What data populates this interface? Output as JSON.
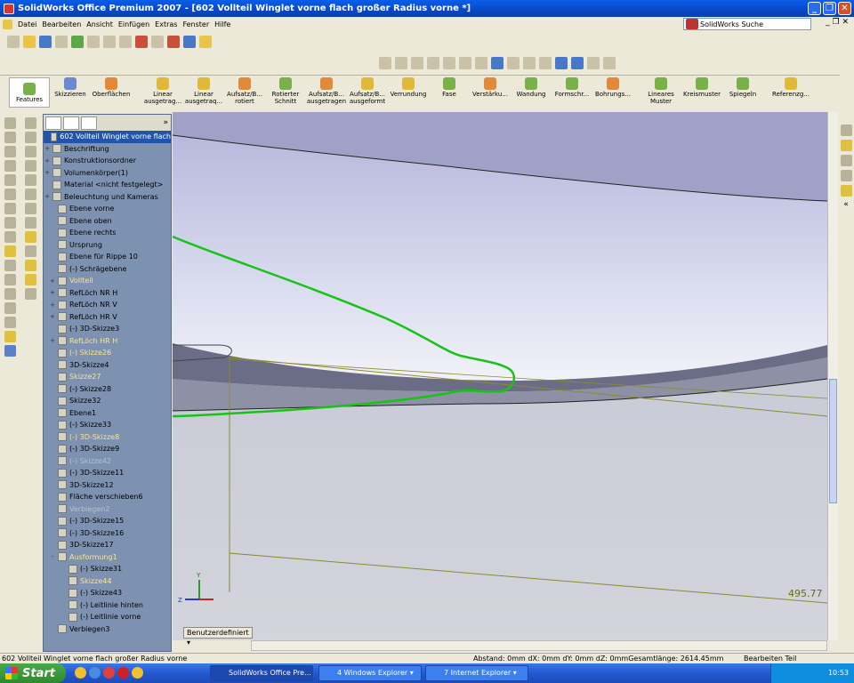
{
  "window": {
    "title": "SolidWorks Office Premium 2007 - [602 Vollteil Winglet vorne flach großer Radius vorne *]"
  },
  "menu": [
    "Datei",
    "Bearbeiten",
    "Ansicht",
    "Einfügen",
    "Extras",
    "Fenster",
    "Hilfe"
  ],
  "search": {
    "placeholder": "SolidWorks Suche"
  },
  "ribbon": {
    "tabs": [
      "Features",
      "Skizzieren",
      "Oberflächen"
    ],
    "tools": [
      "Linear ausgetrag...",
      "Linear ausgetraq...",
      "Aufsatz/B... rotiert",
      "Rotierter Schnitt",
      "Aufsatz/B... ausgetragen",
      "Aufsatz/B... ausgeformt",
      "Verrundung",
      "Fase",
      "Verstärku...",
      "Wandung",
      "Formschr...",
      "Bohrungs...",
      "Lineares Muster",
      "Kreismuster",
      "Spiegeln",
      "Referenzg..."
    ]
  },
  "tree": [
    {
      "label": "602 Vollteil Winglet vorne flach",
      "state": "sel",
      "exp": ""
    },
    {
      "label": "Beschriftung",
      "state": "",
      "exp": "+"
    },
    {
      "label": "Konstruktionsordner",
      "state": "",
      "exp": "+"
    },
    {
      "label": "Volumenkörper(1)",
      "state": "",
      "exp": "+"
    },
    {
      "label": "Material <nicht festgelegt>",
      "state": "",
      "exp": ""
    },
    {
      "label": "Beleuchtung und Kameras",
      "state": "",
      "exp": "+"
    },
    {
      "label": "Ebene vorne",
      "state": "",
      "exp": ""
    },
    {
      "label": "Ebene oben",
      "state": "",
      "exp": ""
    },
    {
      "label": "Ebene rechts",
      "state": "",
      "exp": ""
    },
    {
      "label": "Ursprung",
      "state": "",
      "exp": ""
    },
    {
      "label": "Ebene für Rippe 10",
      "state": "",
      "exp": ""
    },
    {
      "label": "(-) Schrägebene",
      "state": "",
      "exp": ""
    },
    {
      "label": "Vollteil",
      "state": "warn",
      "exp": "+"
    },
    {
      "label": "RefLöch NR H",
      "state": "",
      "exp": "+"
    },
    {
      "label": "RefLöch NR V",
      "state": "",
      "exp": "+"
    },
    {
      "label": "RefLöch HR V",
      "state": "",
      "exp": "+"
    },
    {
      "label": "(-) 3D-Skizze3",
      "state": "",
      "exp": ""
    },
    {
      "label": "RefLöch HR H",
      "state": "warn",
      "exp": "+"
    },
    {
      "label": "(-) Skizze26",
      "state": "warn",
      "exp": ""
    },
    {
      "label": "3D-Skizze4",
      "state": "",
      "exp": ""
    },
    {
      "label": "Skizze27",
      "state": "warn",
      "exp": ""
    },
    {
      "label": "(-) Skizze28",
      "state": "",
      "exp": ""
    },
    {
      "label": "Skizze32",
      "state": "",
      "exp": ""
    },
    {
      "label": "Ebene1",
      "state": "",
      "exp": ""
    },
    {
      "label": "(-) Skizze33",
      "state": "",
      "exp": ""
    },
    {
      "label": "(-) 3D-Skizze8",
      "state": "warn",
      "exp": ""
    },
    {
      "label": "(-) 3D-Skizze9",
      "state": "",
      "exp": ""
    },
    {
      "label": "(-) Skizze42",
      "state": "dim",
      "exp": ""
    },
    {
      "label": "(-) 3D-Skizze11",
      "state": "",
      "exp": ""
    },
    {
      "label": "3D-Skizze12",
      "state": "",
      "exp": ""
    },
    {
      "label": "Fläche verschieben6",
      "state": "",
      "exp": ""
    },
    {
      "label": "Verbiegen2",
      "state": "dim",
      "exp": ""
    },
    {
      "label": "(-) 3D-Skizze15",
      "state": "",
      "exp": ""
    },
    {
      "label": "(-) 3D-Skizze16",
      "state": "",
      "exp": ""
    },
    {
      "label": "3D-Skizze17",
      "state": "",
      "exp": ""
    },
    {
      "label": "Ausformung1",
      "state": "warn",
      "exp": "-"
    },
    {
      "label": "(-) Skizze31",
      "state": "",
      "exp": ""
    },
    {
      "label": "Skizze44",
      "state": "warn",
      "exp": ""
    },
    {
      "label": "(-) Skizze43",
      "state": "",
      "exp": ""
    },
    {
      "label": "(-) Leitlinie hinten",
      "state": "",
      "exp": ""
    },
    {
      "label": "(-) Leitlinie vorne",
      "state": "",
      "exp": ""
    },
    {
      "label": "Verbiegen3",
      "state": "",
      "exp": ""
    }
  ],
  "viewport": {
    "dimension": "495.77",
    "view_label": "Benutzerdefiniert",
    "triad": {
      "x": "X",
      "y": "Y",
      "z": "Z"
    }
  },
  "status": {
    "doc": "602 Vollteil Winglet vorne flach großer Radius vorne",
    "measure": "Abstand: 0mm   dX: 0mm  dY: 0mm  dZ: 0mmGesamtlänge: 2614.45mm",
    "mode": "Bearbeiten Teil"
  },
  "taskbar": {
    "start": "Start",
    "tasks": [
      "SolidWorks Office Pre...",
      "4 Windows Explorer",
      "7 Internet Explorer"
    ],
    "clock": "10:53"
  }
}
